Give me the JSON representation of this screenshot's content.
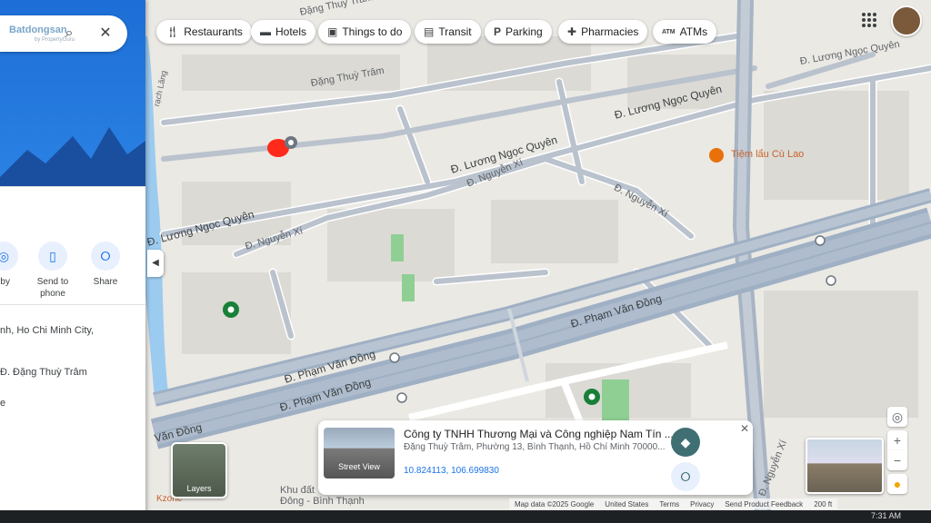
{
  "panel": {
    "brand": "Batdongsan",
    "brand_sub": "by PropertyGuru",
    "actions": [
      {
        "label": "rby",
        "icon": "nearby-icon"
      },
      {
        "label": "Send to phone",
        "icon": "phone-icon"
      },
      {
        "label": "Share",
        "icon": "share-icon"
      }
    ],
    "address_line": "nh, Ho Chi Minh City,",
    "street_line": "Đ. Đặng Thuỳ Trâm",
    "bottom_fragment": "e"
  },
  "chips": [
    {
      "label": "Restaurants",
      "icon": "fork-knife-icon"
    },
    {
      "label": "Hotels",
      "icon": "bed-icon"
    },
    {
      "label": "Things to do",
      "icon": "camera-icon"
    },
    {
      "label": "Transit",
      "icon": "bus-icon"
    },
    {
      "label": "Parking",
      "icon": "parking-icon"
    },
    {
      "label": "Pharmacies",
      "icon": "pharmacy-icon"
    },
    {
      "label": "ATMs",
      "icon": "atm-icon"
    }
  ],
  "streets": {
    "dang_thuy_tram": "Đặng Thuỳ Trâm",
    "luong_ngoc_quyen_1": "Đ. Lương Ngọc Quyên",
    "luong_ngoc_quyen_2": "Đ. Lương Ngọc Quyên",
    "luong_ngoc_quyen_3": "Đ. Lương Ngọc Quyên",
    "luong_ngoc_quyen_4": "Đ. Lương Ngọc Quyên",
    "nguyen_xi_1": "Đ. Nguyễn Xí",
    "nguyen_xi_2": "Đ. Nguyễn Xí",
    "nguyen_xi_3": "Đ. Nguyễn Xí",
    "nguyen_xi_4": "Đ. Nguyễn Xí",
    "pham_van_dong_1": "Đ. Phạm Văn Đồng",
    "pham_van_dong_2": "Đ. Phạm Văn Đồng",
    "pham_van_dong_3": "Đ. Phạm Văn Đồng",
    "pham_van_dong_4": "Văn Đồng",
    "rach_lang": "rạch Lăng",
    "dang_thuy_tram_top": "Đặng Thuỳ Trâm",
    "khu_dat": "Khu đất",
    "dong_binh_thanh": "Đông - Bình Thạnh",
    "kzone": "Kzone"
  },
  "poi": {
    "name": "Tiệm lẩu Cù Lao",
    "color": "#e8710a"
  },
  "card": {
    "title": "Công ty TNHH Thương Mại và Công nghiệp Nam Tín ...",
    "address": "Đặng Thuỳ Trâm, Phường 13, Bình Thạnh, Hồ Chí Minh 70000...",
    "coords": "10.824113, 106.699830",
    "street_view_label": "Street View"
  },
  "layers_label": "Layers",
  "footer": {
    "items": [
      "Map data ©2025 Google",
      "United States",
      "Terms",
      "Privacy",
      "Send Product Feedback",
      "200 ft"
    ]
  },
  "taskbar": {
    "time": "7:31 AM"
  },
  "colors": {
    "road_major": "#9fb0c4",
    "road_minor": "#ffffff",
    "water": "#9ccbf0",
    "park": "#8fcf93",
    "accent": "#1a73e8",
    "pin": "#188038",
    "red_blob": "#ff2a1a"
  }
}
